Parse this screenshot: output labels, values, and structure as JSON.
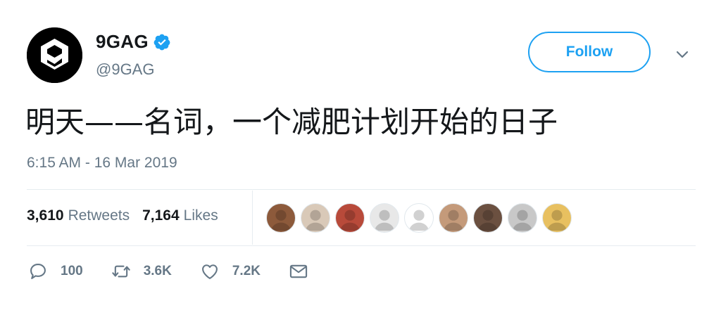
{
  "account": {
    "display_name": "9GAG",
    "handle": "@9GAG",
    "verified": true,
    "avatar_icon": "9gag-logo-icon"
  },
  "follow_button": {
    "label": "Follow"
  },
  "tweet": {
    "text": "明天——名词，一个减肥计划开始的日子",
    "timestamp": "6:15 AM - 16 Mar 2019"
  },
  "stats": {
    "retweets_count": "3,610",
    "retweets_label": "Retweets",
    "likes_count": "7,164",
    "likes_label": "Likes"
  },
  "likers": [
    {
      "icon": "liker-avatar-icon",
      "color": "#8d5a3b"
    },
    {
      "icon": "liker-avatar-icon",
      "color": "#d9c9b8"
    },
    {
      "icon": "liker-avatar-icon",
      "color": "#b84a3a"
    },
    {
      "icon": "liker-avatar-icon",
      "color": "#e8e8e8"
    },
    {
      "icon": "liker-avatar-icon",
      "color": "#ffffff"
    },
    {
      "icon": "liker-avatar-icon",
      "color": "#c49a7a"
    },
    {
      "icon": "liker-avatar-icon",
      "color": "#6b5040"
    },
    {
      "icon": "liker-avatar-icon",
      "color": "#c8c8c8"
    },
    {
      "icon": "liker-avatar-icon",
      "color": "#e8c060"
    }
  ],
  "actions": {
    "reply_count": "100",
    "retweet_count": "3.6K",
    "like_count": "7.2K"
  },
  "colors": {
    "accent": "#1da1f2",
    "muted": "#657786",
    "text": "#14171a",
    "divider": "#e6ecf0"
  }
}
